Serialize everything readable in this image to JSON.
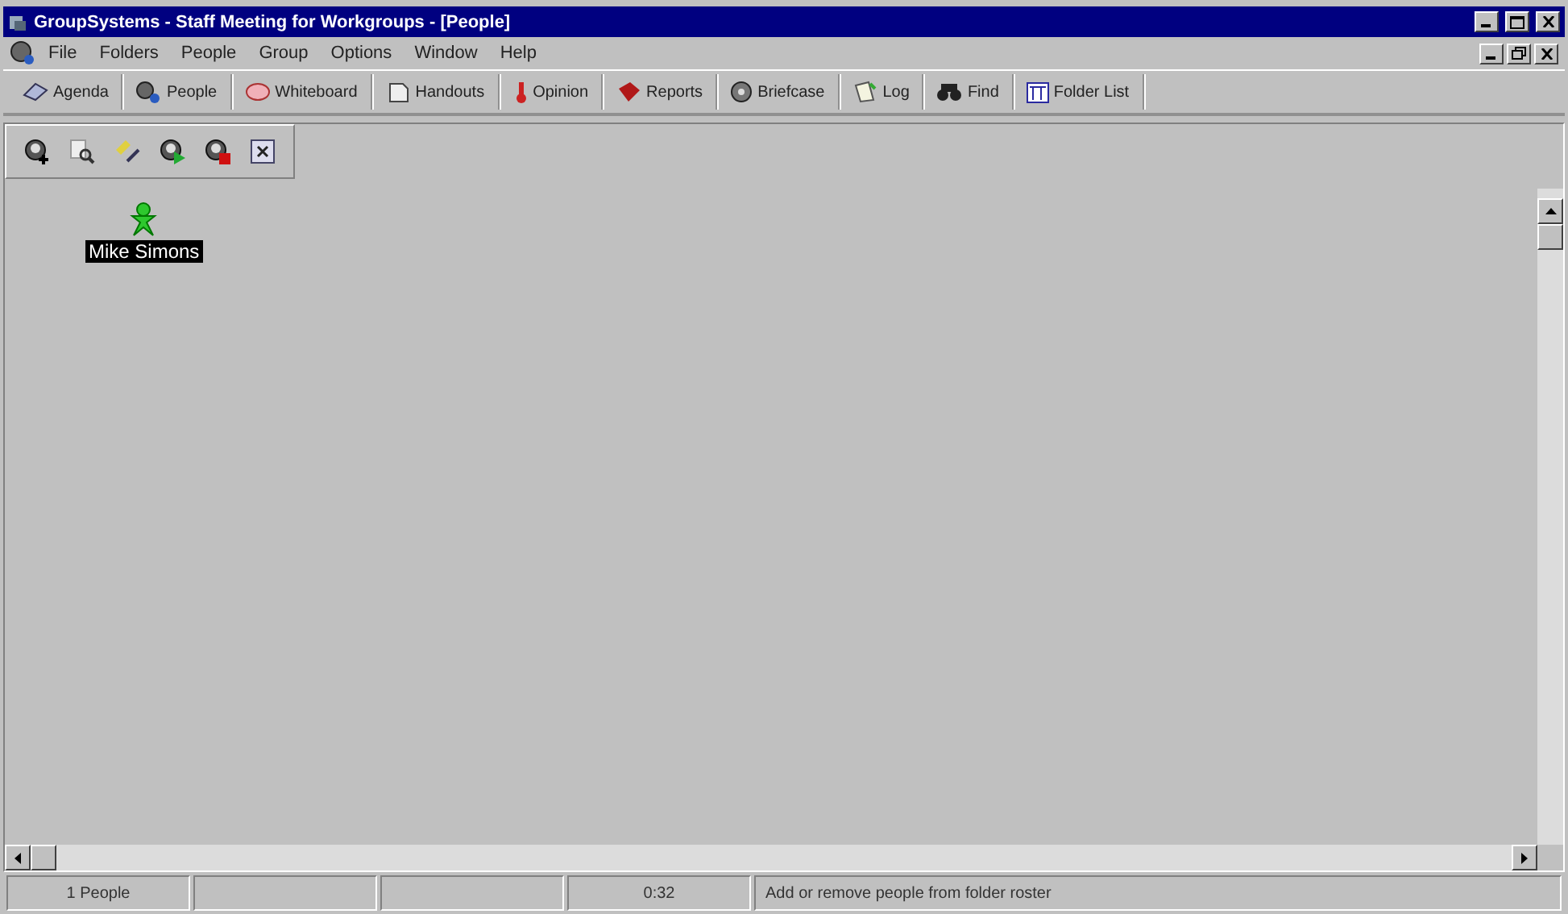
{
  "window": {
    "title": "GroupSystems - Staff Meeting for Workgroups - [People]"
  },
  "menu": [
    "File",
    "Folders",
    "People",
    "Group",
    "Options",
    "Window",
    "Help"
  ],
  "toolbar": [
    {
      "label": "Agenda",
      "kind": "agenda"
    },
    {
      "label": "People",
      "kind": "people"
    },
    {
      "label": "Whiteboard",
      "kind": "whiteboard"
    },
    {
      "label": "Handouts",
      "kind": "handouts"
    },
    {
      "label": "Opinion",
      "kind": "opinion"
    },
    {
      "label": "Reports",
      "kind": "reports"
    },
    {
      "label": "Briefcase",
      "kind": "briefcase"
    },
    {
      "label": "Log",
      "kind": "log"
    },
    {
      "label": "Find",
      "kind": "find"
    },
    {
      "label": "Folder List",
      "kind": "folderlist"
    }
  ],
  "people_toolbar": [
    {
      "kind": "add"
    },
    {
      "kind": "view"
    },
    {
      "kind": "edit"
    },
    {
      "kind": "start"
    },
    {
      "kind": "stop"
    },
    {
      "kind": "close"
    }
  ],
  "people": [
    {
      "name": "Mike Simons",
      "selected": true
    }
  ],
  "status_bar": [
    {
      "text": "1 People"
    },
    {
      "text": "0:32"
    },
    {
      "text": "Add or remove people from folder roster"
    }
  ]
}
